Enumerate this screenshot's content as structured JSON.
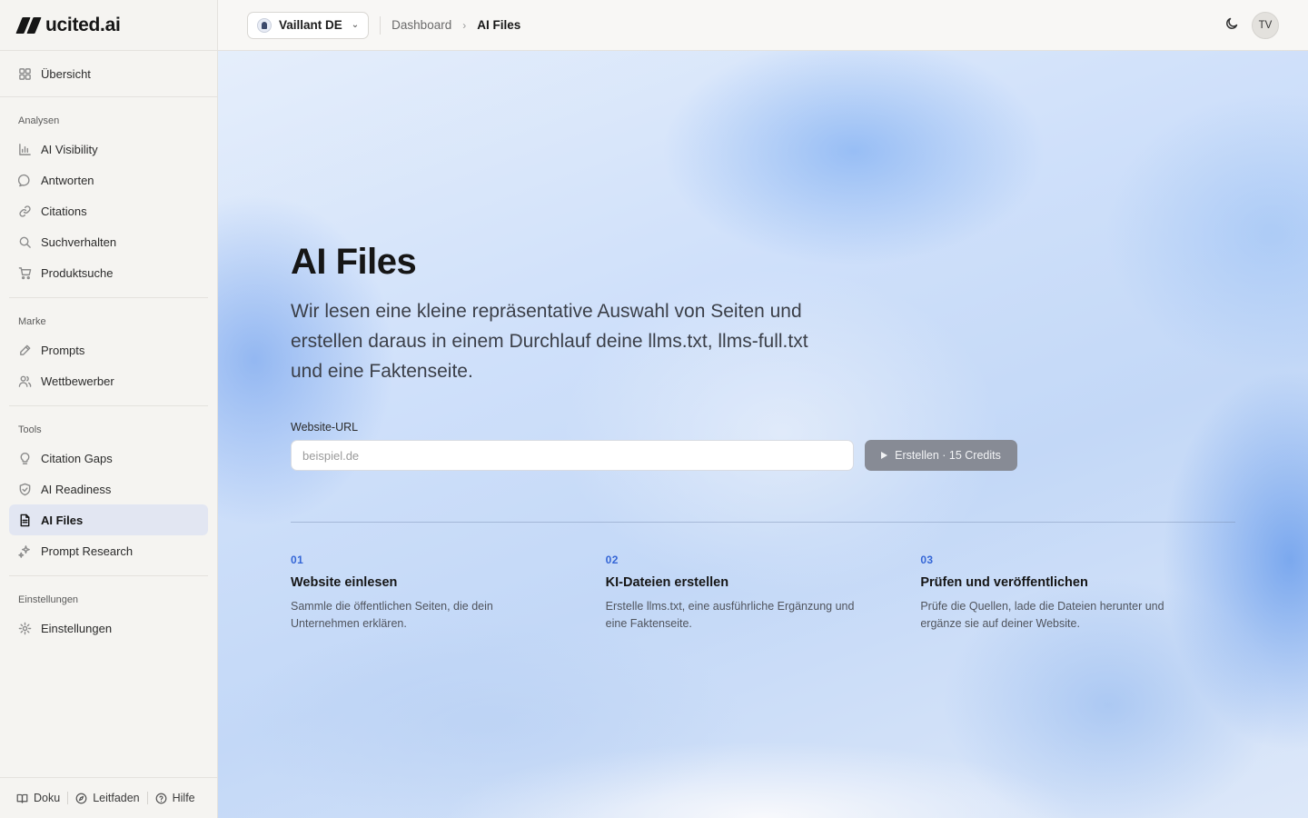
{
  "brand": {
    "name": "ucited.ai"
  },
  "sidebar": {
    "top": {
      "label": "Übersicht",
      "icon": "grid-icon"
    },
    "groups": [
      {
        "label": "Analysen",
        "items": [
          {
            "label": "AI Visibility",
            "icon": "bar-chart-icon"
          },
          {
            "label": "Antworten",
            "icon": "chat-bubble-icon"
          },
          {
            "label": "Citations",
            "icon": "link-icon"
          },
          {
            "label": "Suchverhalten",
            "icon": "search-icon"
          },
          {
            "label": "Produktsuche",
            "icon": "cart-icon"
          }
        ]
      },
      {
        "label": "Marke",
        "items": [
          {
            "label": "Prompts",
            "icon": "pen-icon"
          },
          {
            "label": "Wettbewerber",
            "icon": "users-icon"
          }
        ]
      },
      {
        "label": "Tools",
        "items": [
          {
            "label": "Citation Gaps",
            "icon": "lightbulb-icon"
          },
          {
            "label": "AI Readiness",
            "icon": "shield-check-icon"
          },
          {
            "label": "AI Files",
            "icon": "file-icon",
            "active": true
          },
          {
            "label": "Prompt Research",
            "icon": "sparkle-icon"
          }
        ]
      },
      {
        "label": "Einstellungen",
        "items": [
          {
            "label": "Einstellungen",
            "icon": "gear-icon"
          }
        ]
      }
    ],
    "footer": [
      {
        "label": "Doku",
        "icon": "book-icon"
      },
      {
        "label": "Leitfaden",
        "icon": "compass-icon"
      },
      {
        "label": "Hilfe",
        "icon": "help-circle-icon"
      }
    ]
  },
  "header": {
    "workspace": "Vaillant DE",
    "breadcrumb": [
      "Dashboard",
      "AI Files"
    ],
    "avatar_initials": "TV",
    "theme_icon": "moon-icon"
  },
  "hero": {
    "title": "AI Files",
    "description": "Wir lesen eine kleine repräsentative Auswahl von Seiten und erstellen daraus in einem Durchlauf deine llms.txt, llms-full.txt und eine Faktenseite.",
    "url_label": "Website-URL",
    "url_placeholder": "beispiel.de",
    "url_value": "",
    "create_button": "Erstellen · 15 Credits"
  },
  "steps": [
    {
      "num": "01",
      "title": "Website einlesen",
      "desc": "Sammle die öffentlichen Seiten, die dein Unternehmen erklären."
    },
    {
      "num": "02",
      "title": "KI-Dateien erstellen",
      "desc": "Erstelle llms.txt, eine ausführliche Ergänzung und eine Faktenseite."
    },
    {
      "num": "03",
      "title": "Prüfen und veröffentlichen",
      "desc": "Prüfe die Quellen, lade die Dateien herunter und ergänze sie auf deiner Website."
    }
  ],
  "colors": {
    "accent": "#3566d6",
    "active_nav_bg": "#e2e6f2",
    "button_bg": "#878b95"
  }
}
